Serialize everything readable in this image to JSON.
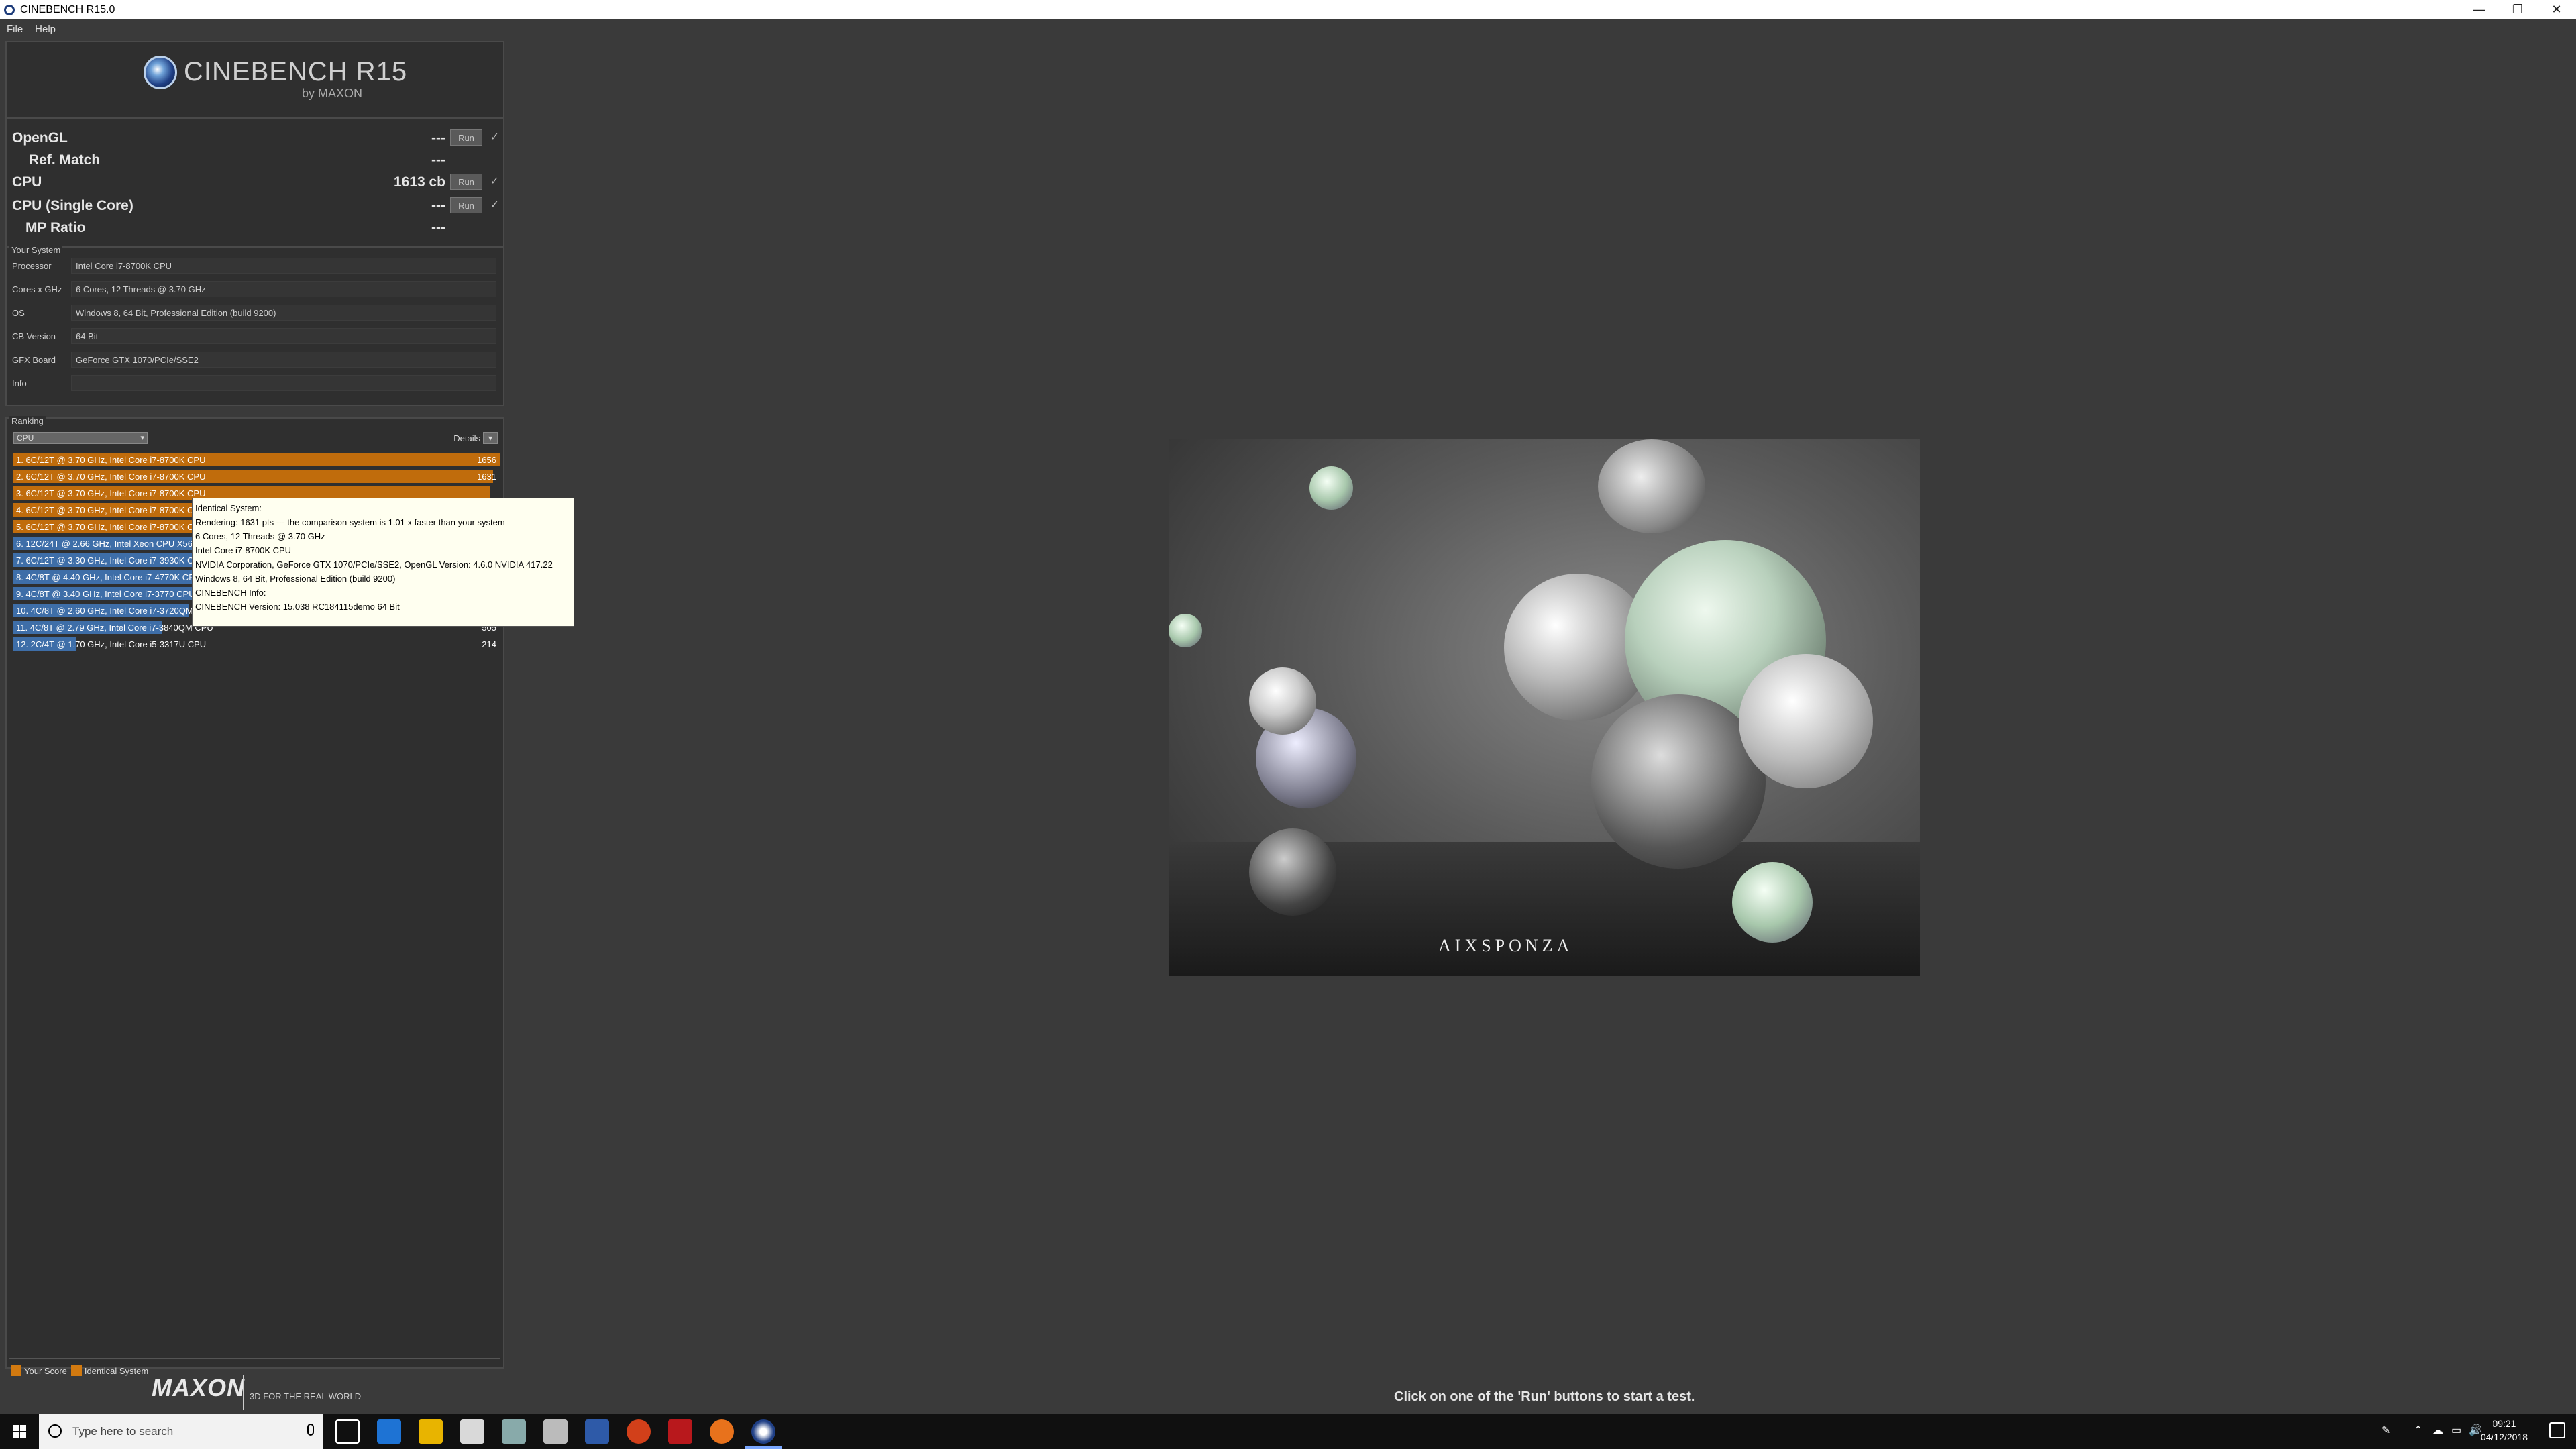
{
  "window": {
    "title": "CINEBENCH R15.0"
  },
  "menu": {
    "file": "File",
    "help": "Help"
  },
  "logo": {
    "title": "CINEBENCH R15",
    "sub": "by MAXON"
  },
  "bench": {
    "opengl_label": "OpenGL",
    "opengl_value": "---",
    "refmatch_label": "Ref. Match",
    "refmatch_value": "---",
    "cpu_label": "CPU",
    "cpu_value": "1613 cb",
    "cpu_single_label": "CPU (Single Core)",
    "cpu_single_value": "---",
    "mp_label": "MP Ratio",
    "mp_value": "---",
    "run_label": "Run",
    "check": "✓"
  },
  "system": {
    "title": "Your System",
    "rows": [
      {
        "label": "Processor",
        "value": "Intel Core i7-8700K CPU"
      },
      {
        "label": "Cores x GHz",
        "value": "6 Cores, 12 Threads @ 3.70 GHz"
      },
      {
        "label": "OS",
        "value": "Windows 8, 64 Bit, Professional Edition (build 9200)"
      },
      {
        "label": "CB Version",
        "value": "64 Bit"
      },
      {
        "label": "GFX Board",
        "value": "GeForce GTX 1070/PCIe/SSE2"
      },
      {
        "label": "Info",
        "value": ""
      }
    ]
  },
  "ranking": {
    "title": "Ranking",
    "select": "CPU",
    "details": "Details",
    "details_btn": "▾",
    "items": [
      {
        "label": "1. 6C/12T @ 3.70 GHz, Intel Core i7-8700K CPU",
        "score": "1656",
        "color": "orange",
        "fill": 1.0
      },
      {
        "label": "2. 6C/12T @ 3.70 GHz, Intel Core i7-8700K CPU",
        "score": "1631",
        "color": "orange",
        "fill": 0.985
      },
      {
        "label": "3. 6C/12T @ 3.70 GHz, Intel Core i7-8700K CPU",
        "score": "",
        "color": "orange",
        "fill": 0.98
      },
      {
        "label": "4. 6C/12T @ 3.70 GHz, Intel Core i7-8700K CPU",
        "score": "",
        "color": "orange",
        "fill": 0.975
      },
      {
        "label": "5. 6C/12T @ 3.70 GHz, Intel Core i7-8700K CPU",
        "score": "",
        "color": "orange",
        "fill": 0.97
      },
      {
        "label": "6. 12C/24T @ 2.66 GHz, Intel Xeon CPU X5650",
        "score": "",
        "color": "blue",
        "fill": 0.72
      },
      {
        "label": "7. 6C/12T @ 3.30 GHz, Intel Core i7-3930K CPU",
        "score": "",
        "color": "blue",
        "fill": 0.67
      },
      {
        "label": "8. 4C/8T @ 4.40 GHz, Intel Core i7-4770K CPU",
        "score": "",
        "color": "blue",
        "fill": 0.48
      },
      {
        "label": "9. 4C/8T @ 3.40 GHz, Intel Core i7-3770 CPU",
        "score": "",
        "color": "blue",
        "fill": 0.4
      },
      {
        "label": "10. 4C/8T @ 2.60 GHz, Intel Core i7-3720QM CPU",
        "score": "",
        "color": "blue",
        "fill": 0.36
      },
      {
        "label": "11. 4C/8T @ 2.79 GHz, Intel Core i7-3840QM CPU",
        "score": "505",
        "color": "blue",
        "fill": 0.305
      },
      {
        "label": "12. 2C/4T @ 1.70 GHz,  Intel Core i5-3317U CPU",
        "score": "214",
        "color": "blue",
        "fill": 0.13
      }
    ],
    "legend_your": "Your Score",
    "legend_identical": "Identical System"
  },
  "tooltip": {
    "lines": [
      "Identical System:",
      "Rendering: 1631 pts --- the comparison system is 1.01 x faster than your system",
      "6 Cores, 12 Threads @ 3.70 GHz",
      "Intel Core i7-8700K CPU",
      "NVIDIA Corporation, GeForce GTX 1070/PCIe/SSE2, OpenGL Version: 4.6.0 NVIDIA 417.22",
      "Windows 8, 64 Bit, Professional Edition (build 9200)",
      "CINEBENCH Info:",
      "CINEBENCH Version: 15.038 RC184115demo 64 Bit"
    ]
  },
  "scene": {
    "brand": "AIXSPONZA"
  },
  "footer": {
    "maxon": "MAXON",
    "tagline": "3D FOR THE REAL WORLD",
    "status": "Click on one of the 'Run' buttons to start a test."
  },
  "taskbar": {
    "search_placeholder": "Type here to search",
    "time": "09:21",
    "date": "04/12/2018"
  },
  "colors": {
    "orange": "#c06c0c",
    "blue": "#3e6ea8",
    "background": "#3a3a3a"
  }
}
